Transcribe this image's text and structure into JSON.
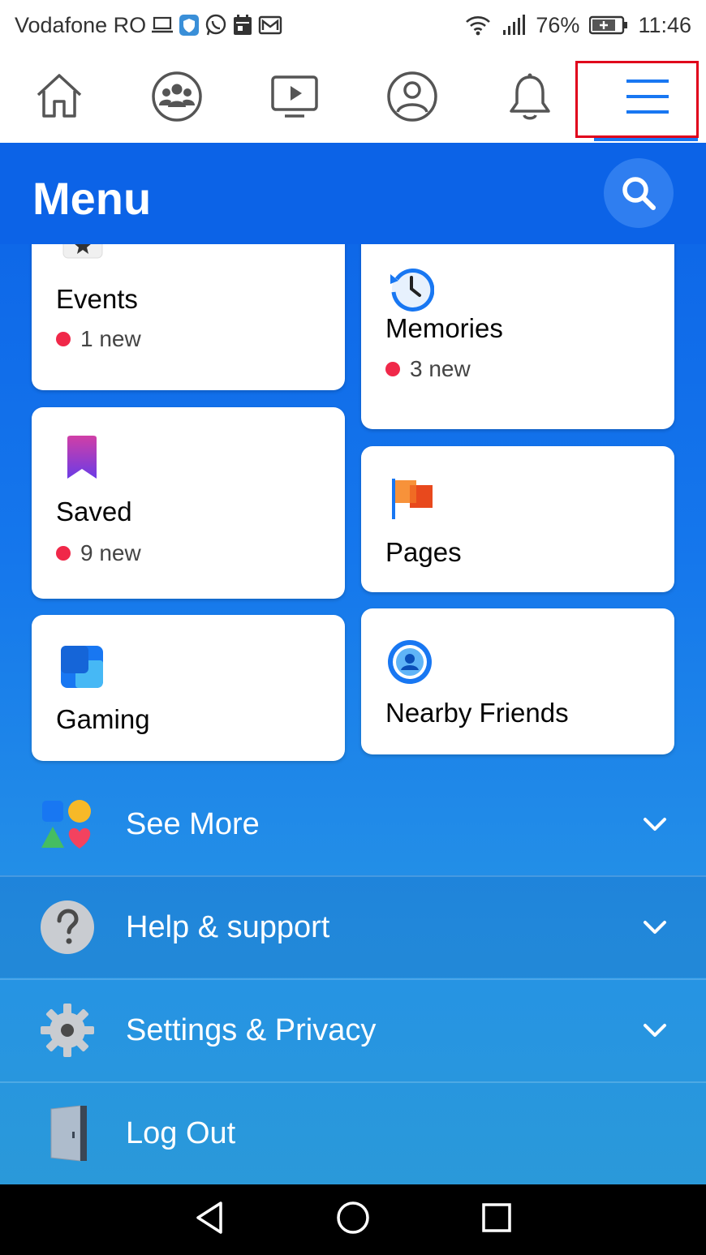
{
  "status": {
    "carrier": "Vodafone RO",
    "battery": "76%",
    "time": "11:46"
  },
  "tabs": [
    {
      "name": "home-icon"
    },
    {
      "name": "groups-icon"
    },
    {
      "name": "watch-icon"
    },
    {
      "name": "profile-icon"
    },
    {
      "name": "bell-icon"
    },
    {
      "name": "hamburger-menu-icon",
      "active": true
    }
  ],
  "menu": {
    "title": "Menu"
  },
  "shortcuts": {
    "events": {
      "label": "Events",
      "badge": "1 new"
    },
    "memories": {
      "label": "Memories",
      "badge": "3 new"
    },
    "saved": {
      "label": "Saved",
      "badge": "9 new"
    },
    "pages": {
      "label": "Pages"
    },
    "gaming": {
      "label": "Gaming"
    },
    "nearby": {
      "label": "Nearby Friends"
    }
  },
  "rows": {
    "see_more": "See More",
    "help": "Help & support",
    "settings": "Settings & Privacy",
    "logout": "Log Out"
  },
  "colors": {
    "accent": "#1877f2",
    "menu_bg": "#0c63e7",
    "badge_dot": "#f02849",
    "highlight": "#e0001b"
  }
}
